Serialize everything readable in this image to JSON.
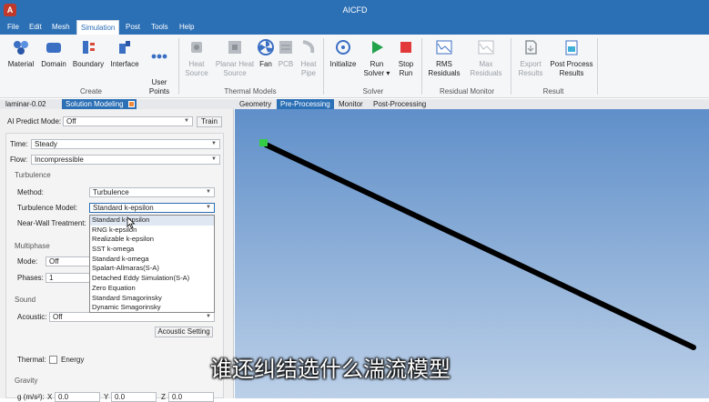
{
  "window": {
    "title": "AICFD"
  },
  "menu": [
    "File",
    "Edit",
    "Mesh",
    "Simulation",
    "Post",
    "Tools",
    "Help"
  ],
  "ribbon": {
    "create": {
      "group": "Create",
      "buttons": [
        "Material",
        "Domain",
        "Boundary",
        "Interface",
        "User\nPoints"
      ]
    },
    "thermal": {
      "group": "Thermal Models",
      "buttons": [
        "Heat\nSource",
        "Planar Heat\nSource",
        "Fan",
        "PCB",
        "Heat\nPipe"
      ]
    },
    "solver": {
      "group": "Solver",
      "buttons": [
        "Initialize",
        "Run\nSolver ▾",
        "Stop\nRun"
      ]
    },
    "residual": {
      "group": "Residual Monitor",
      "buttons": [
        "RMS\nResiduals",
        "Max\nResiduals"
      ]
    },
    "result": {
      "group": "Result",
      "buttons": [
        "Export\nResults",
        "Post Process\nResults"
      ]
    }
  },
  "left_tabs": {
    "case": "laminar-0.02",
    "panel": "Solution Modeling"
  },
  "view_tabs": [
    "Geometry",
    "Pre-Processing",
    "Monitor",
    "Post-Processing"
  ],
  "active_view_tab": "Pre-Processing",
  "panel": {
    "ai_predict_label": "AI Predict Mode:",
    "ai_predict_value": "Off",
    "train_label": "Train",
    "time_label": "Time:",
    "time_value": "Steady",
    "flow_label": "Flow:",
    "flow_value": "Incompressible",
    "turbulence_section": "Turbulence",
    "method_label": "Method:",
    "method_value": "Turbulence",
    "turb_model_label": "Turbulence Model:",
    "turb_model_value": "Standard k-epsilon",
    "near_wall_label": "Near-Wall Treatment:",
    "multiphase_section": "Multiphase",
    "mode_label": "Mode:",
    "mode_value": "Off",
    "phases_label": "Phases:",
    "phases_value": "1",
    "sound_section": "Sound",
    "acoustic_label": "Acoustic:",
    "acoustic_value": "Off",
    "acoustic_setting": "Acoustic Setting",
    "thermal_label": "Thermal:",
    "energy_label": "Energy",
    "gravity_section": "Gravity",
    "gravity_unit": "g (m/s²):",
    "gx_label": "X",
    "gx": "0.0",
    "gy_label": "Y",
    "gy": "0.0",
    "gz_label": "Z",
    "gz": "0.0"
  },
  "turbulence_options": [
    "Standard k-epsilon",
    "RNG k-epsilon",
    "Realizable k-epsilon",
    "SST k-omega",
    "Standard k-omega",
    "Spalart-Allmaras(S-A)",
    "Detached Eddy Simulation(S-A)",
    "Zero Equation",
    "Standard Smagorinsky",
    "Dynamic Smagorinsky"
  ],
  "subtitle": "谁还纠结选什么湍流模型",
  "colors": {
    "titlebar": "#2b6fb5",
    "accent": "#2b6fb5",
    "viewport_top": "#5f8fc9",
    "viewport_bottom": "#bcd0e8",
    "model_line": "#000000",
    "model_marker": "#33cc44"
  }
}
